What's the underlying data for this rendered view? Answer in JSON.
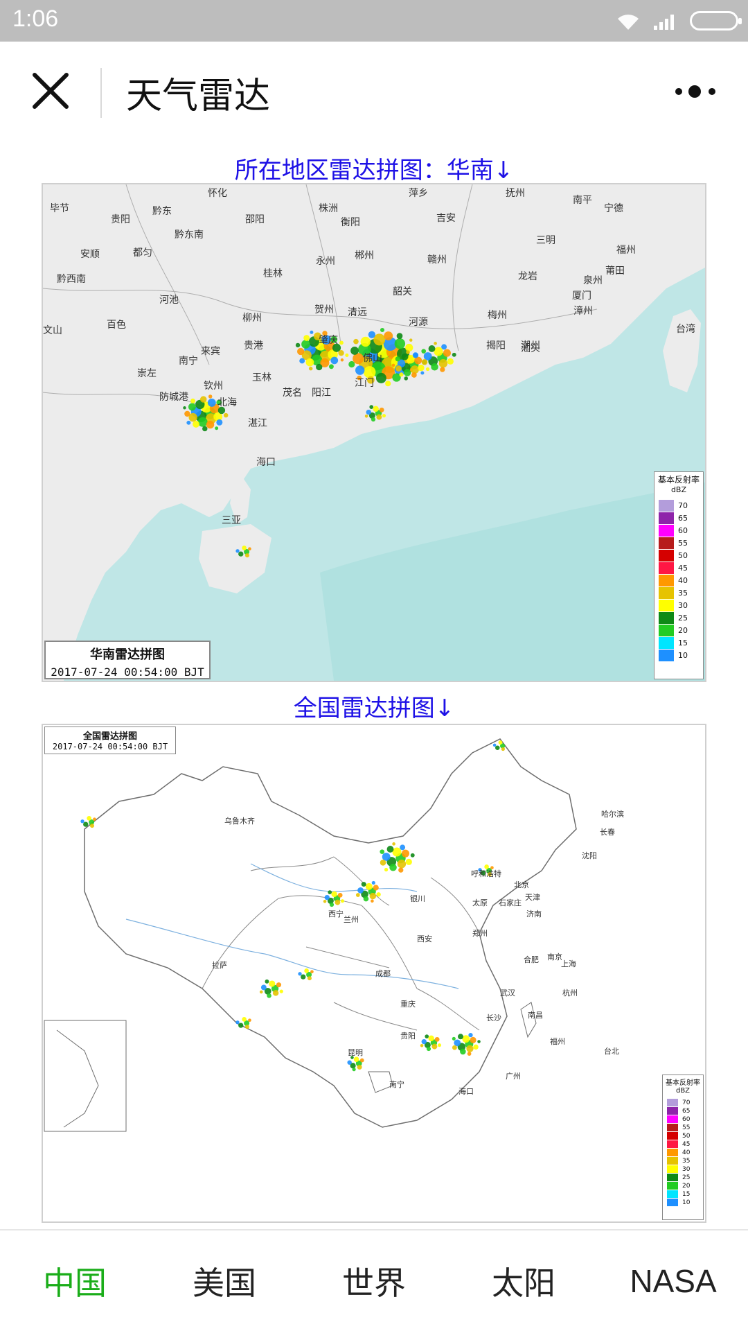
{
  "status_bar": {
    "time": "1:06"
  },
  "title_bar": {
    "title": "天气雷达"
  },
  "content": {
    "regional_link": "所在地区雷达拼图：华南↓",
    "national_link": "全国雷达拼图↓",
    "regional_map": {
      "caption_title": "华南雷达拼图",
      "caption_time": "2017-07-24 00:54:00 BJT",
      "legend_title": "基本反射率",
      "legend_unit": "dBZ",
      "legend_values": [
        "70",
        "65",
        "60",
        "55",
        "50",
        "45",
        "40",
        "35",
        "30",
        "25",
        "20",
        "15",
        "10"
      ],
      "cities": [
        "毕节",
        "怀化",
        "株洲",
        "萍乡",
        "抚州",
        "南平",
        "宁德",
        "贵阳",
        "黔东",
        "邵阳",
        "衡阳",
        "吉安",
        "三明",
        "福州",
        "安顺",
        "都匀",
        "黔东南",
        "永州",
        "郴州",
        "赣州",
        "龙岩",
        "莆田",
        "黔西南",
        "桂林",
        "韶关",
        "泉州",
        "河池",
        "贺州",
        "清远",
        "河源",
        "梅州",
        "厦门",
        "漳州",
        "台湾",
        "百色",
        "柳州",
        "肇庆",
        "佛山",
        "潮州",
        "文山",
        "来宾",
        "贵港",
        "揭阳",
        "汕头",
        "南宁",
        "崇左",
        "钦州",
        "玉林",
        "江门",
        "茂名",
        "阳江",
        "防城港",
        "北海",
        "湛江",
        "海口",
        "三亚"
      ]
    },
    "national_map": {
      "caption_title": "全国雷达拼图",
      "caption_time": "2017-07-24 00:54:00 BJT",
      "legend_title": "基本反射率",
      "legend_unit": "dBZ",
      "legend_values": [
        "70",
        "65",
        "60",
        "55",
        "50",
        "45",
        "40",
        "35",
        "30",
        "25",
        "20",
        "15",
        "10"
      ],
      "cities": [
        "乌鲁木齐",
        "哈尔滨",
        "长春",
        "沈阳",
        "呼和浩特",
        "北京",
        "天津",
        "银川",
        "太原",
        "石家庄",
        "西宁",
        "兰州",
        "济南",
        "西安",
        "郑州",
        "合肥",
        "南京",
        "上海",
        "拉萨",
        "成都",
        "武汉",
        "杭州",
        "重庆",
        "长沙",
        "南昌",
        "贵阳",
        "昆明",
        "福州",
        "台北",
        "南宁",
        "广州",
        "海口"
      ]
    }
  },
  "bottom_nav": {
    "items": [
      "中国",
      "美国",
      "世界",
      "太阳",
      "NASA"
    ]
  },
  "colors": {
    "accent": "#1aad19",
    "link": "#1d10e6",
    "sea": "#bfe6e6",
    "land": "#ececec"
  },
  "legend_colors": [
    "#b39ddb",
    "#8e24aa",
    "#ff00ff",
    "#b71c1c",
    "#d50000",
    "#ff1744",
    "#ff9800",
    "#e6c300",
    "#ffff00",
    "#0e8a16",
    "#22cc22",
    "#00e5ff",
    "#1e90ff"
  ]
}
